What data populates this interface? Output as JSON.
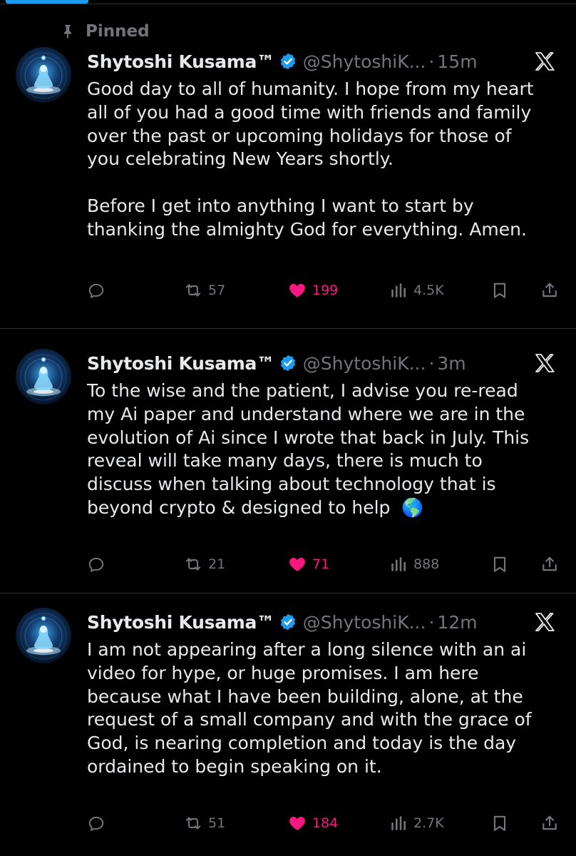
{
  "pinned_label": "Pinned",
  "colors": {
    "background": "#000000",
    "text": "#e7e9ea",
    "muted": "#71767b",
    "accent": "#1d9bf0",
    "like": "#f91880",
    "divider": "#2f3336"
  },
  "icons": {
    "pin": "pin-icon",
    "verified": "verified-badge-icon",
    "source": "x-logo-icon",
    "reply": "reply-icon",
    "repost": "repost-icon",
    "like": "heart-icon",
    "views": "views-icon",
    "bookmark": "bookmark-icon",
    "share": "share-icon"
  },
  "tweets": [
    {
      "name": "Shytoshi Kusama™",
      "handle": "@ShytoshiK...",
      "separator": "·",
      "time": "15m",
      "text": "Good day to all of humanity. I hope from my heart\nall of you had a good time with friends and family\nover the past or upcoming holidays for those of\nyou celebrating New Years shortly.\n\nBefore I get into anything I want to start by\nthanking the almighty God for everything. Amen.",
      "reposts": "57",
      "likes": "199",
      "views": "4.5K"
    },
    {
      "name": "Shytoshi Kusama™",
      "handle": "@ShytoshiK...",
      "separator": "·",
      "time": "3m",
      "text": "To the wise and the patient, I advise you re-read\nmy Ai paper and understand where we are in the\nevolution of Ai since I wrote that back in July. This\nreveal will take many days, there is much to\ndiscuss when talking about technology that is\nbeyond crypto & designed to help  🌎",
      "reposts": "21",
      "likes": "71",
      "views": "888"
    },
    {
      "name": "Shytoshi Kusama™",
      "handle": "@ShytoshiK...",
      "separator": "·",
      "time": "12m",
      "text": "I am not appearing after a long silence with an ai\nvideo for hype, or huge promises. I am here\nbecause what I have been building, alone, at the\nrequest of a small company and with the grace of\nGod, is nearing completion and today is the day\nordained to begin speaking on it.",
      "reposts": "51",
      "likes": "184",
      "views": "2.7K"
    }
  ]
}
